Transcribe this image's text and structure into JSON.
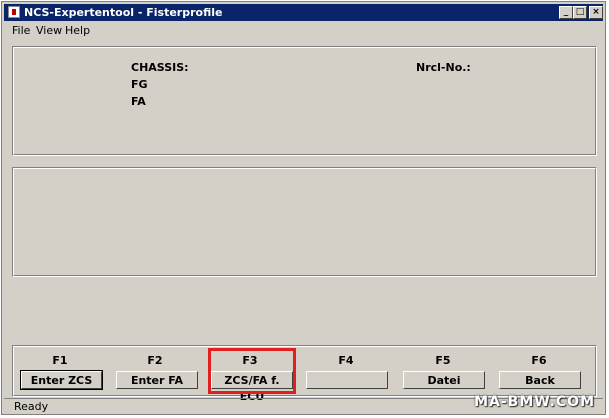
{
  "window": {
    "title": "NCS-Expertentool - Fisterprofile",
    "controls": {
      "minimize": "_",
      "maximize": "□",
      "close": "×"
    }
  },
  "menu": {
    "file": "File",
    "view": "View",
    "help": "Help"
  },
  "info_panel": {
    "chassis_label": "CHASSIS:",
    "fg_label": "FG",
    "fa_label": "FA",
    "nrcl_label": "Nrcl-No.:"
  },
  "function_keys": [
    {
      "key": "F1",
      "label": "Enter ZCS"
    },
    {
      "key": "F2",
      "label": "Enter FA"
    },
    {
      "key": "F3",
      "label": "ZCS/FA f. ECU"
    },
    {
      "key": "F4",
      "label": ""
    },
    {
      "key": "F5",
      "label": "Datei"
    },
    {
      "key": "F6",
      "label": "Back"
    }
  ],
  "status": {
    "text": "Ready"
  },
  "watermark": {
    "text": "MA-BMW.COM"
  },
  "colors": {
    "titlebar": "#0a246a",
    "highlight": "#e0201e",
    "face": "#d4d0c8"
  }
}
